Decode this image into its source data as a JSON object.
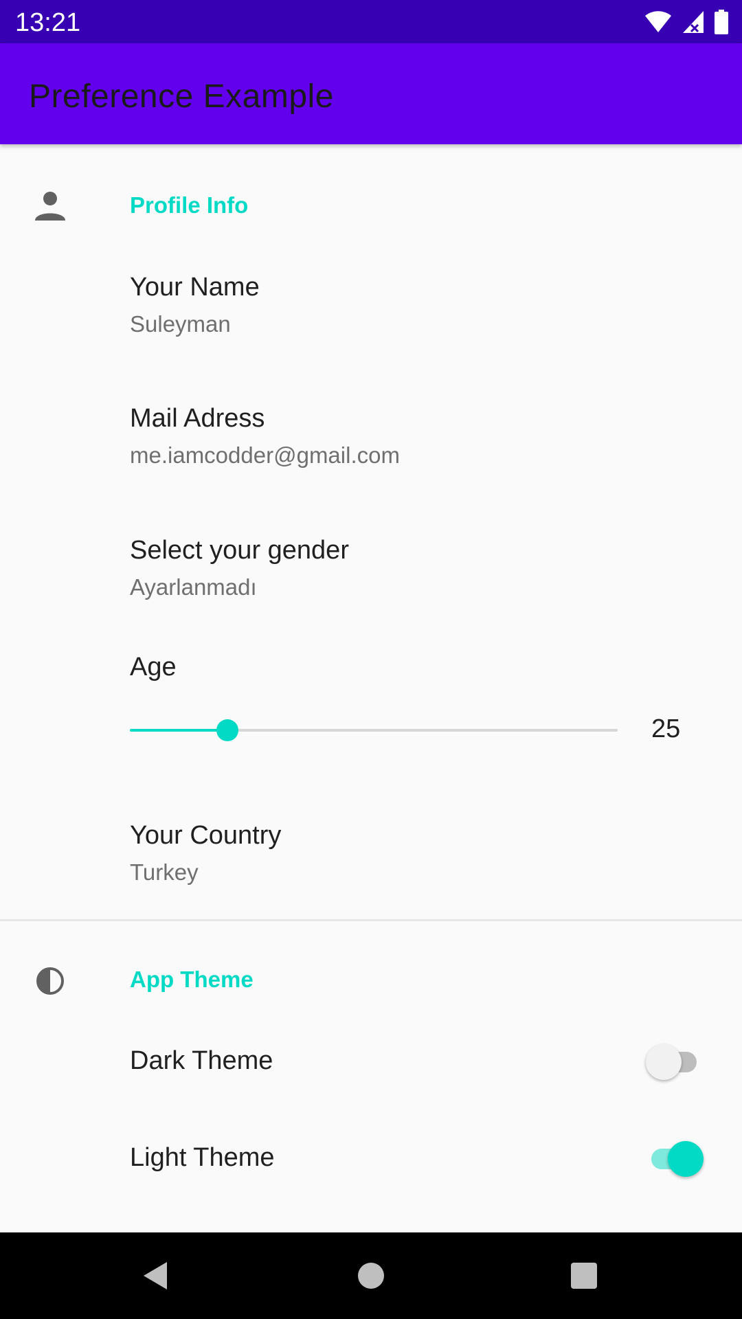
{
  "status_bar": {
    "time": "13:21",
    "icons": [
      "wifi-icon",
      "cellular-signal-icon",
      "battery-icon"
    ]
  },
  "app_bar": {
    "title": "Preference Example",
    "color": "#6200ee"
  },
  "categories": {
    "profile": {
      "title": "Profile Info",
      "icon": "person-icon"
    },
    "theme": {
      "title": "App Theme",
      "icon": "contrast-icon"
    }
  },
  "preferences": {
    "name": {
      "title": "Your Name",
      "summary": "Suleyman"
    },
    "mail": {
      "title": "Mail Adress",
      "summary": "me.iamcodder@gmail.com"
    },
    "gender": {
      "title": "Select your gender",
      "summary": "Ayarlanmadı"
    },
    "age": {
      "title": "Age",
      "value": "25",
      "fraction": 0.2
    },
    "country": {
      "title": "Your Country",
      "summary": "Turkey"
    },
    "dark_theme": {
      "title": "Dark Theme",
      "checked": false
    },
    "light_theme": {
      "title": "Light Theme",
      "checked": true
    }
  },
  "colors": {
    "accent": "#03dac5",
    "primary": "#6200ee",
    "primary_dark": "#3700b3"
  },
  "nav_bar": {
    "icons": [
      "back-icon",
      "home-icon",
      "recents-icon"
    ]
  }
}
